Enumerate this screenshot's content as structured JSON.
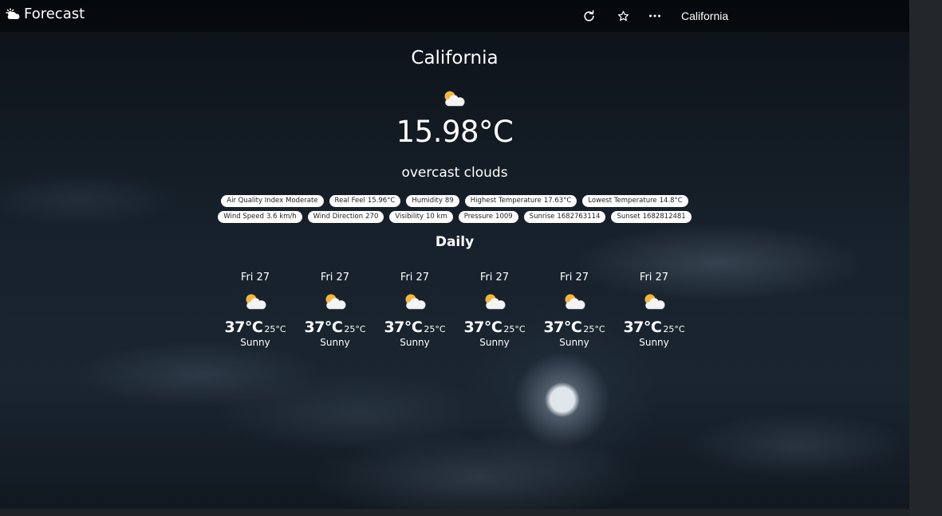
{
  "navbar": {
    "brand": "Forecast",
    "brand_icon": "cloud-sun-icon",
    "refresh_icon": "refresh-icon",
    "favorite_icon": "star-icon",
    "more_icon": "more-horizontal-icon",
    "location": "California"
  },
  "current": {
    "city": "California",
    "icon": "partly-cloudy-icon",
    "temperature": "15.98°C",
    "description": "overcast clouds"
  },
  "details_row1": [
    {
      "label": "Air Quality Index",
      "value": "Moderate"
    },
    {
      "label": "Real Feel",
      "value": "15.96°C"
    },
    {
      "label": "Humidity",
      "value": "89"
    },
    {
      "label": "Highest Temperature",
      "value": "17.63°C"
    },
    {
      "label": "Lowest Temperature",
      "value": "14.8°C"
    }
  ],
  "details_row2": [
    {
      "label": "Wind Speed",
      "value": "3.6 km/h"
    },
    {
      "label": "Wind Direction",
      "value": "270"
    },
    {
      "label": "Visibility",
      "value": "10 km"
    },
    {
      "label": "Pressure",
      "value": "1009"
    },
    {
      "label": "Sunrise",
      "value": "1682763114"
    },
    {
      "label": "Sunset",
      "value": "1682812481"
    }
  ],
  "daily": {
    "heading": "Daily",
    "days": [
      {
        "name": "Fri 27",
        "icon": "partly-cloudy-icon",
        "high": "37°C",
        "low": "25°C",
        "desc": "Sunny"
      },
      {
        "name": "Fri 27",
        "icon": "partly-cloudy-icon",
        "high": "37°C",
        "low": "25°C",
        "desc": "Sunny"
      },
      {
        "name": "Fri 27",
        "icon": "partly-cloudy-icon",
        "high": "37°C",
        "low": "25°C",
        "desc": "Sunny"
      },
      {
        "name": "Fri 27",
        "icon": "partly-cloudy-icon",
        "high": "37°C",
        "low": "25°C",
        "desc": "Sunny"
      },
      {
        "name": "Fri 27",
        "icon": "partly-cloudy-icon",
        "high": "37°C",
        "low": "25°C",
        "desc": "Sunny"
      },
      {
        "name": "Fri 27",
        "icon": "partly-cloudy-icon",
        "high": "37°C",
        "low": "25°C",
        "desc": "Sunny"
      }
    ]
  },
  "colors": {
    "chip_background": "#ffffff",
    "chip_text": "#222222",
    "sun": "#f7b731",
    "cloud": "#f4f4f4"
  }
}
